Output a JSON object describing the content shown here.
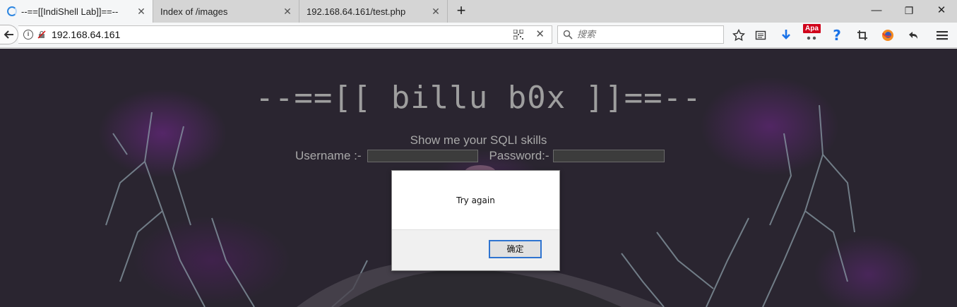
{
  "tabs": [
    {
      "label": "--==[[IndiShell Lab]]==--",
      "active": true,
      "icon": "loading-icon"
    },
    {
      "label": "Index of /images",
      "active": false
    },
    {
      "label": "192.168.64.161/test.php",
      "active": false
    }
  ],
  "window_controls": {
    "minimize": "—",
    "restore": "❐",
    "close": "✕"
  },
  "navbar": {
    "url": "192.168.64.161",
    "search_placeholder": "搜索",
    "addon_badge": "Apa"
  },
  "page": {
    "title": "--==[[ billu b0x ]]==--",
    "subtitle": "Show me your SQLI skills",
    "username_label": "Username :-",
    "password_label": "Password:-"
  },
  "dialog": {
    "message": "Try again",
    "ok_label": "确定"
  },
  "colors": {
    "page_bg": "#2a2530",
    "glow": "#7a2896",
    "title_text": "#9e9e9e",
    "accent_blue": "#2f74d0",
    "download_blue": "#1a73e8",
    "badge_red": "#d0021b"
  }
}
